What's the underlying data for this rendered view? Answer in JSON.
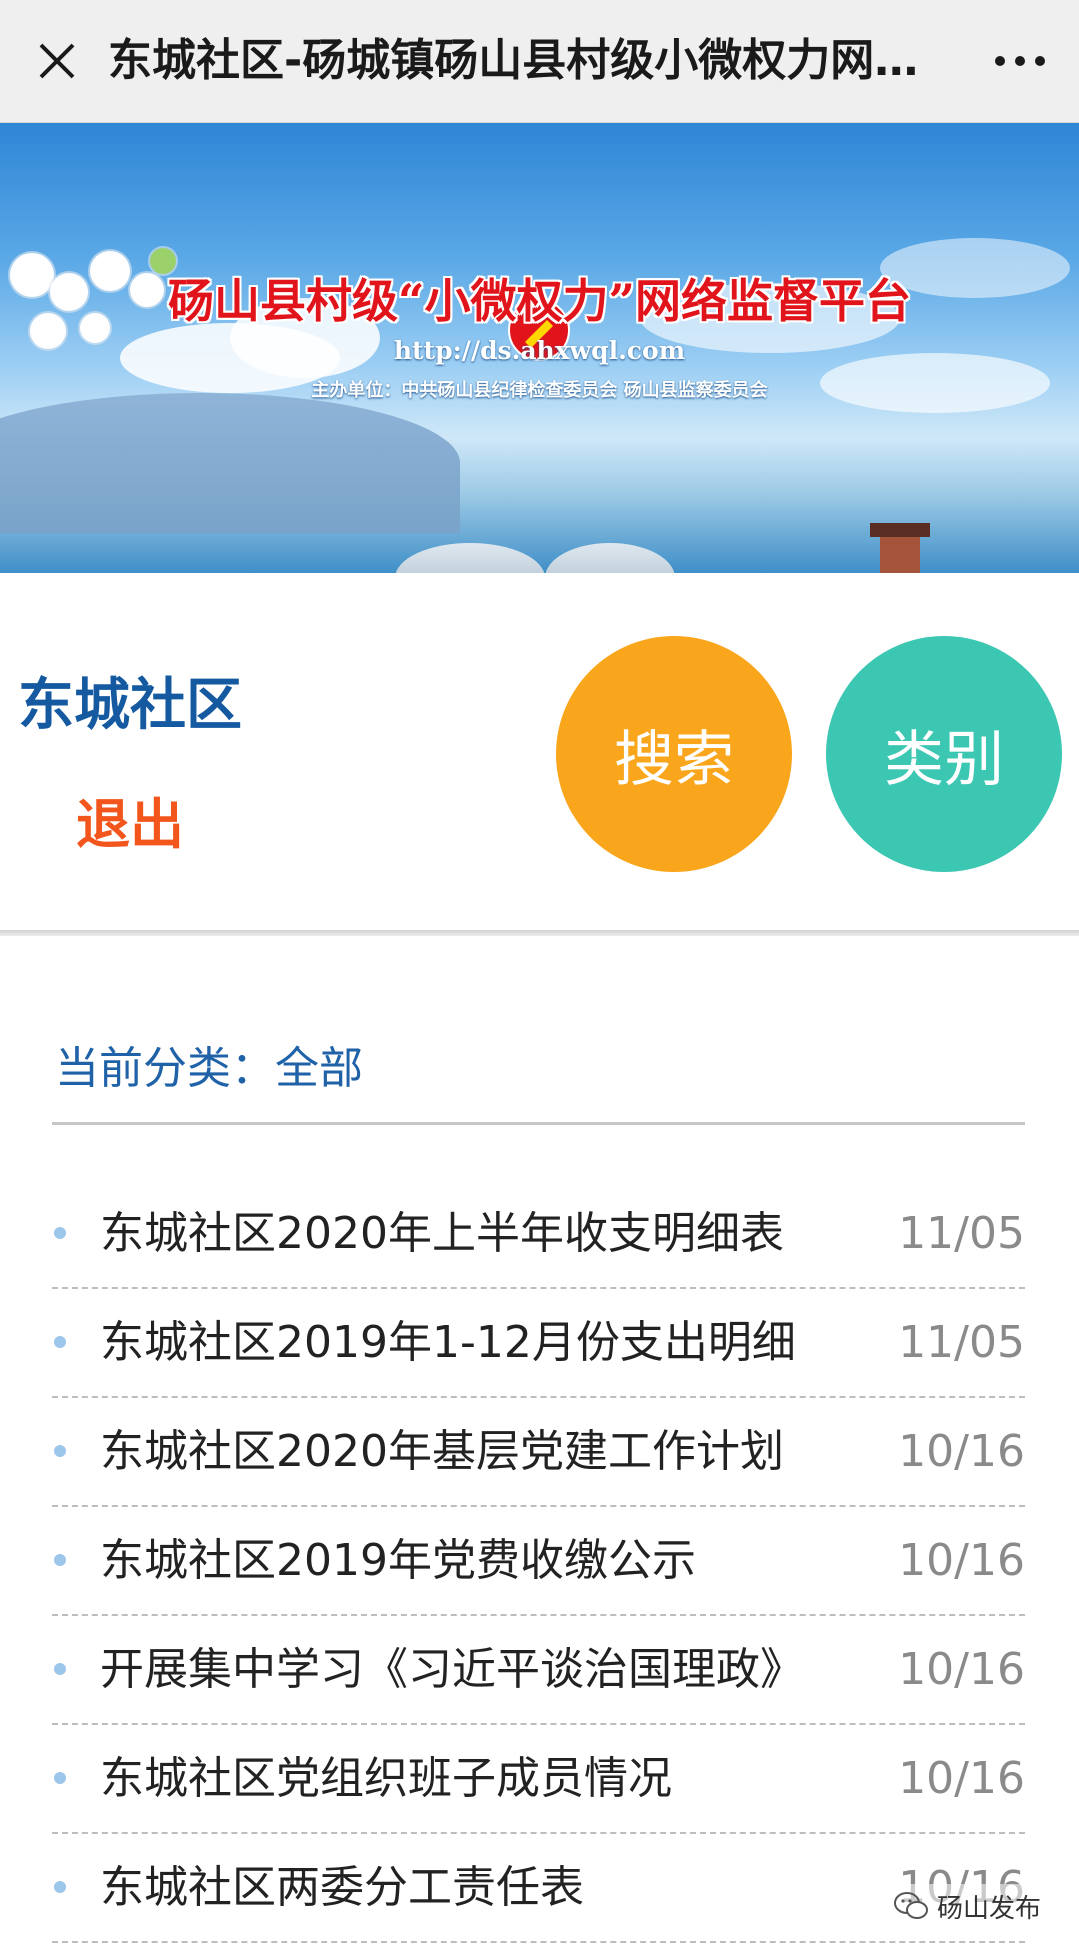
{
  "topbar": {
    "title": "东城社区-砀城镇砀山县村级小微权力网络…"
  },
  "banner": {
    "title": "砀山县村级“小微权力”网络监督平台",
    "url": "http://ds.ahxwql.com",
    "host": "主办单位：中共砀山县纪律检查委员会  砀山县监察委员会",
    "emblem_icon": "party-emblem",
    "accent_color": "#e0141a"
  },
  "header": {
    "org_name": "东城社区",
    "logout_label": "退出",
    "search_label": "搜索",
    "category_label": "类别",
    "search_color": "#f9a61c",
    "category_color": "#3cc7b2"
  },
  "category": {
    "label": "当前分类：全部"
  },
  "list": [
    {
      "title": "东城社区2020年上半年收支明细表",
      "date": "11/05"
    },
    {
      "title": "东城社区2019年1-12月份支出明细",
      "date": "11/05"
    },
    {
      "title": "东城社区2020年基层党建工作计划",
      "date": "10/16"
    },
    {
      "title": "东城社区2019年党费收缴公示",
      "date": "10/16"
    },
    {
      "title": "开展集中学习《习近平谈治国理政》",
      "date": "10/16"
    },
    {
      "title": "东城社区党组织班子成员情况",
      "date": "10/16"
    },
    {
      "title": "东城社区两委分工责任表",
      "date": "10/16"
    }
  ],
  "watermark": {
    "text": "砀山发布",
    "icon": "wechat-icon"
  }
}
